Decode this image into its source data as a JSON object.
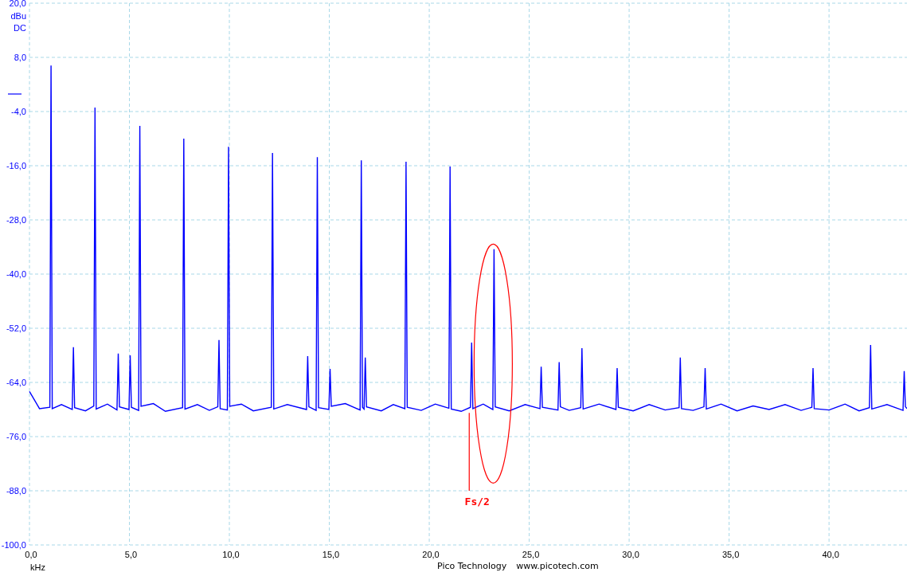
{
  "coupling_label": "DC",
  "chart_data": {
    "type": "line",
    "xlabel": "kHz",
    "ylabel": "dBu",
    "grid": true,
    "xlim": [
      0,
      43.9
    ],
    "ylim": [
      -100,
      20
    ],
    "xticks": [
      {
        "value": 0,
        "label": "0,0"
      },
      {
        "value": 5,
        "label": "5,0"
      },
      {
        "value": 10,
        "label": "10,0"
      },
      {
        "value": 15,
        "label": "15,0"
      },
      {
        "value": 20,
        "label": "20,0"
      },
      {
        "value": 25,
        "label": "25,0"
      },
      {
        "value": 30,
        "label": "30,0"
      },
      {
        "value": 35,
        "label": "35,0"
      },
      {
        "value": 40,
        "label": "40,0"
      }
    ],
    "yticks": [
      {
        "value": 20,
        "label": "20,0"
      },
      {
        "value": 8,
        "label": "8,0"
      },
      {
        "value": -4,
        "label": "-4,0"
      },
      {
        "value": -16,
        "label": "-16,0"
      },
      {
        "value": -28,
        "label": "-28,0"
      },
      {
        "value": -40,
        "label": "-40,0"
      },
      {
        "value": -52,
        "label": "-52,0"
      },
      {
        "value": -64,
        "label": "-64,0"
      },
      {
        "value": -76,
        "label": "-76,0"
      },
      {
        "value": -88,
        "label": "-88,0"
      },
      {
        "value": -100,
        "label": "-100,0"
      }
    ],
    "x": [
      0,
      0.5,
      1.02,
      1.08,
      1.14,
      1.6,
      2.14,
      2.2,
      2.26,
      2.8,
      3.22,
      3.28,
      3.34,
      3.9,
      4.38,
      4.44,
      4.5,
      4.98,
      5.04,
      5.1,
      5.46,
      5.52,
      5.58,
      6.2,
      6.8,
      7.66,
      7.72,
      7.78,
      8.4,
      9.0,
      9.42,
      9.48,
      9.54,
      9.9,
      9.96,
      10.02,
      10.6,
      11.2,
      12.1,
      12.16,
      12.22,
      12.9,
      13.86,
      13.92,
      13.98,
      14.34,
      14.4,
      14.46,
      14.98,
      15.04,
      15.1,
      15.8,
      16.54,
      16.6,
      16.66,
      16.74,
      16.8,
      16.86,
      17.6,
      18.2,
      18.78,
      18.84,
      18.9,
      19.6,
      20.3,
      20.98,
      21.04,
      21.1,
      21.6,
      22.06,
      22.12,
      22.18,
      22.7,
      23.18,
      23.24,
      23.3,
      24.0,
      24.8,
      25.54,
      25.6,
      25.66,
      26.44,
      26.5,
      26.56,
      27.0,
      27.58,
      27.64,
      27.7,
      28.5,
      29.34,
      29.4,
      29.46,
      30.2,
      31.0,
      31.8,
      32.5,
      32.56,
      32.62,
      33.2,
      33.74,
      33.8,
      33.86,
      34.6,
      35.4,
      36.2,
      37.0,
      37.8,
      38.6,
      39.14,
      39.2,
      39.26,
      40.0,
      40.8,
      41.5,
      42.02,
      42.08,
      42.14,
      42.9,
      43.7,
      43.76,
      43.82,
      43.9
    ],
    "series": [
      {
        "color": "#0000ff",
        "values": [
          -66,
          -69.8,
          -69.5,
          6.2,
          -69.8,
          -68.9,
          -70,
          -56.2,
          -69.6,
          -70.3,
          -69.2,
          -3.1,
          -69.9,
          -68.8,
          -70.1,
          -57.6,
          -69.4,
          -70,
          -58,
          -69.5,
          -70.2,
          -7.2,
          -69.3,
          -68.7,
          -70.4,
          -69.6,
          -10,
          -69.9,
          -68.9,
          -70.2,
          -69.4,
          -54.6,
          -69.8,
          -70.1,
          -11.8,
          -69.3,
          -68.8,
          -70.3,
          -69.5,
          -13.2,
          -69.9,
          -68.9,
          -70,
          -58.2,
          -69.4,
          -70.2,
          -14.1,
          -69.6,
          -70,
          -61,
          -69.3,
          -68.7,
          -70.1,
          -14.8,
          -69.5,
          -69.9,
          -58.5,
          -69.4,
          -70.3,
          -68.9,
          -69.8,
          -15.1,
          -69.5,
          -70.2,
          -68.8,
          -69.7,
          -16.2,
          -69.9,
          -70.4,
          -69.5,
          -55.2,
          -69.8,
          -68.8,
          -70,
          -34.5,
          -69.4,
          -70.3,
          -68.9,
          -69.8,
          -60.5,
          -69.5,
          -70.1,
          -59.5,
          -69.4,
          -70.2,
          -69.6,
          -56.4,
          -69.9,
          -68.8,
          -70,
          -60.8,
          -69.5,
          -70.3,
          -68.9,
          -70.1,
          -69.6,
          -58.5,
          -69.8,
          -70.2,
          -69.4,
          -60.8,
          -69.9,
          -68.8,
          -70.3,
          -69.2,
          -70,
          -68.9,
          -70.2,
          -69.5,
          -60.8,
          -69.8,
          -70.1,
          -68.8,
          -70.3,
          -69.6,
          -55.7,
          -69.9,
          -68.9,
          -70.2,
          -61.5,
          -69.4,
          -69.8
        ]
      }
    ],
    "annotations": [
      "Fs/2"
    ]
  },
  "footer": {
    "company": "Pico Technology",
    "website": "www.picotech.com"
  }
}
